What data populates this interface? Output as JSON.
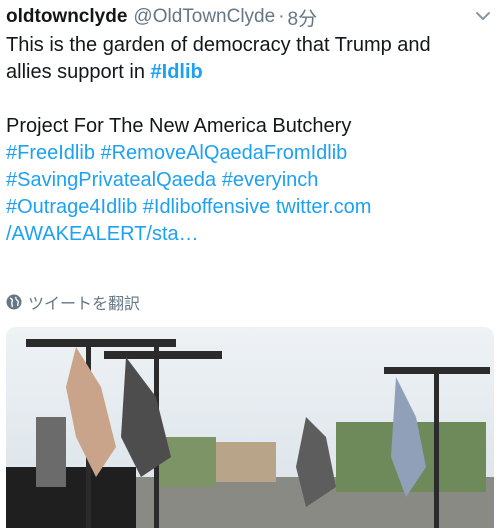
{
  "tweet": {
    "display_name": "oldtownclyde",
    "handle": "@OldTownClyde",
    "separator": "·",
    "time": "8分",
    "lines": {
      "l1": "This is the garden of democracy that Trump and",
      "l2_text": "allies support in ",
      "l2_tag": "#Idlib",
      "l3": "Project For The New America Butchery",
      "l4": "#FreeIdlib #RemoveAlQaedaFromIdlib",
      "l5": "#SavingPrivatealQaeda #everyinch",
      "l6_tags": "#Outrage4Idlib #Idliboffensive ",
      "l6_link": "twitter.com",
      "l7_link": "/AWAKEALERT/sta…"
    },
    "translate_label": "ツイートを翻訳"
  },
  "colors": {
    "link": "#1da1f2",
    "secondary_text": "#657786",
    "primary_text": "#14171a"
  },
  "icons": [
    "chevron-down-icon",
    "globe-icon"
  ]
}
